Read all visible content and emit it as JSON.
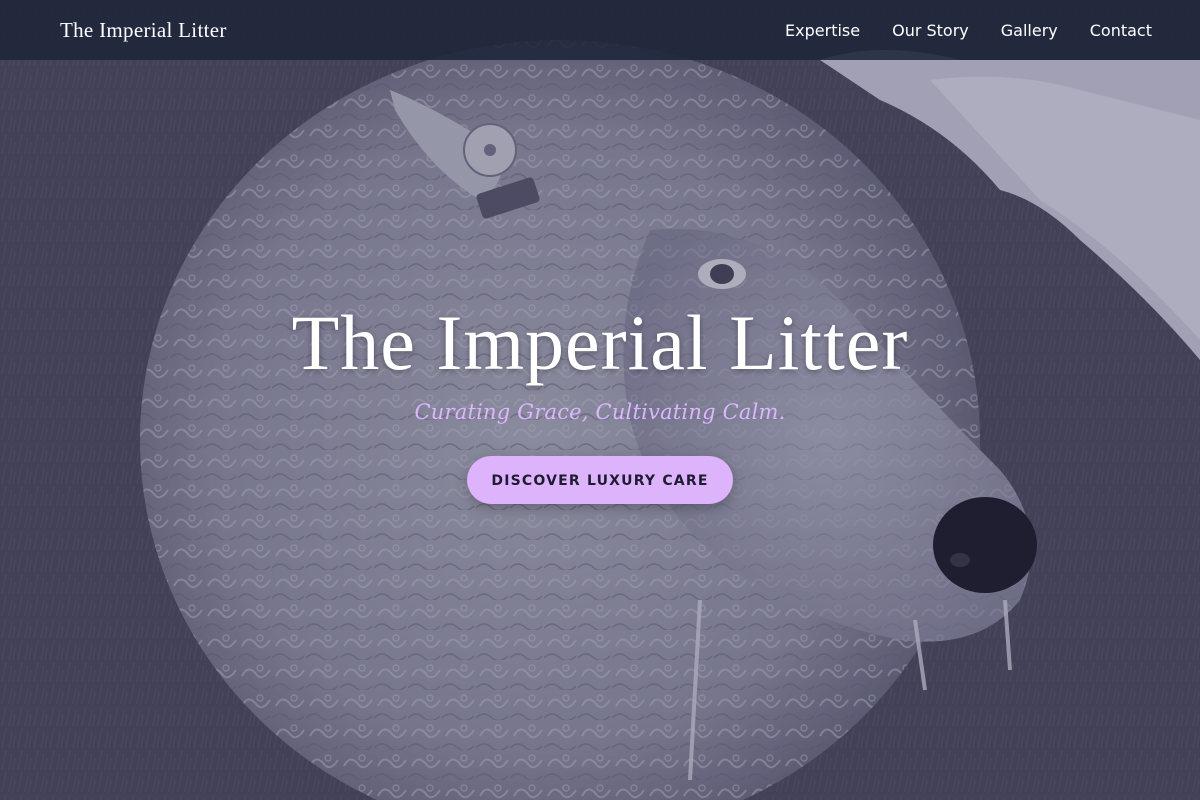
{
  "header": {
    "brand": "The Imperial Litter",
    "nav": [
      {
        "label": "Expertise"
      },
      {
        "label": "Our Story"
      },
      {
        "label": "Gallery"
      },
      {
        "label": "Contact"
      }
    ]
  },
  "hero": {
    "title": "The Imperial Litter",
    "tagline": "Curating Grace, Cultivating Calm.",
    "cta_label": "DISCOVER LUXURY CARE",
    "image": "woolly-sheep-photo"
  },
  "colors": {
    "nav_background": "#1e263a",
    "accent": "#ddb3fc",
    "tagline": "#dcb6ff",
    "title": "#ffffff"
  }
}
